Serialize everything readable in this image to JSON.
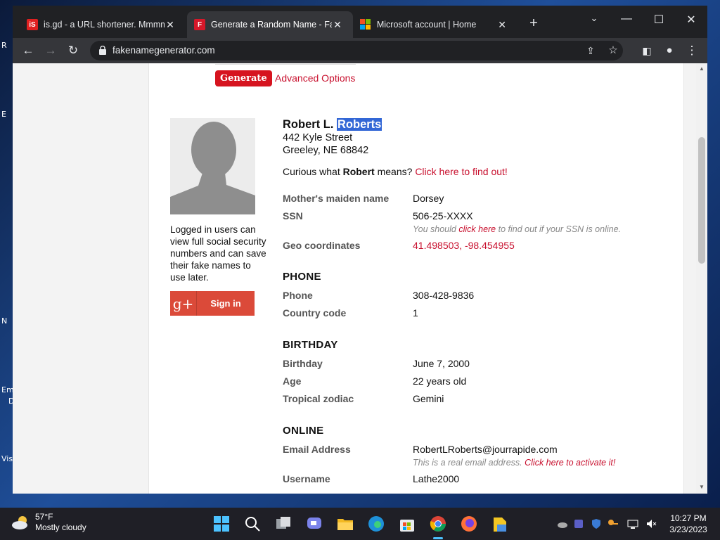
{
  "browser": {
    "tabs": [
      {
        "title": "is.gd - a URL shortener. Mmmm, s",
        "favicon": "isgd-icon"
      },
      {
        "title": "Generate a Random Name - Fake",
        "favicon": "fng-icon"
      },
      {
        "title": "Microsoft account | Home",
        "favicon": "microsoft-icon"
      }
    ],
    "url": "fakenamegenerator.com"
  },
  "desktop": {
    "labels": [
      "R",
      "E",
      "N",
      "Em",
      "D",
      "Vis"
    ]
  },
  "page": {
    "generate_label": "Generate",
    "advanced_label": "Advanced Options",
    "login_note": "Logged in users can view full social security numbers and can save their fake names to use later.",
    "signin_label": "Sign in",
    "gplus_glyph": "g+",
    "name_first": "Robert L.",
    "name_last": "Roberts",
    "address_line1": "442 Kyle Street",
    "address_line2": "Greeley, NE 68842",
    "curious_prefix": "Curious what",
    "curious_name": "Robert",
    "curious_middle": "means?",
    "curious_link": "Click here to find out!",
    "maiden_label": "Mother's maiden name",
    "maiden_value": "Dorsey",
    "ssn_label": "SSN",
    "ssn_value": "506-25-XXXX",
    "ssn_note_prefix": "You should",
    "ssn_note_link": "click here",
    "ssn_note_suffix": "to find out if your SSN is online.",
    "geo_label": "Geo coordinates",
    "geo_value": "41.498503, -98.454955",
    "phone_section": "PHONE",
    "phone_label": "Phone",
    "phone_value": "308-428-9836",
    "country_label": "Country code",
    "country_value": "1",
    "birthday_section": "BIRTHDAY",
    "birthday_label": "Birthday",
    "birthday_value": "June 7, 2000",
    "age_label": "Age",
    "age_value": "22 years old",
    "zodiac_label": "Tropical zodiac",
    "zodiac_value": "Gemini",
    "online_section": "ONLINE",
    "email_label": "Email Address",
    "email_value": "RobertLRoberts@jourrapide.com",
    "email_note_prefix": "This is a real email address.",
    "email_note_link": "Click here to activate it!",
    "username_label": "Username",
    "username_value": "Lathe2000"
  },
  "taskbar": {
    "temperature": "57°F",
    "condition": "Mostly cloudy",
    "time": "10:27 PM",
    "date": "3/23/2023"
  },
  "colors": {
    "accent_red": "#c8102e",
    "generate_red": "#d6141f",
    "gplus_red": "#db4a39",
    "selection_blue": "#3367d6",
    "tab_bg": "#202124",
    "toolbar_bg": "#35363a"
  }
}
